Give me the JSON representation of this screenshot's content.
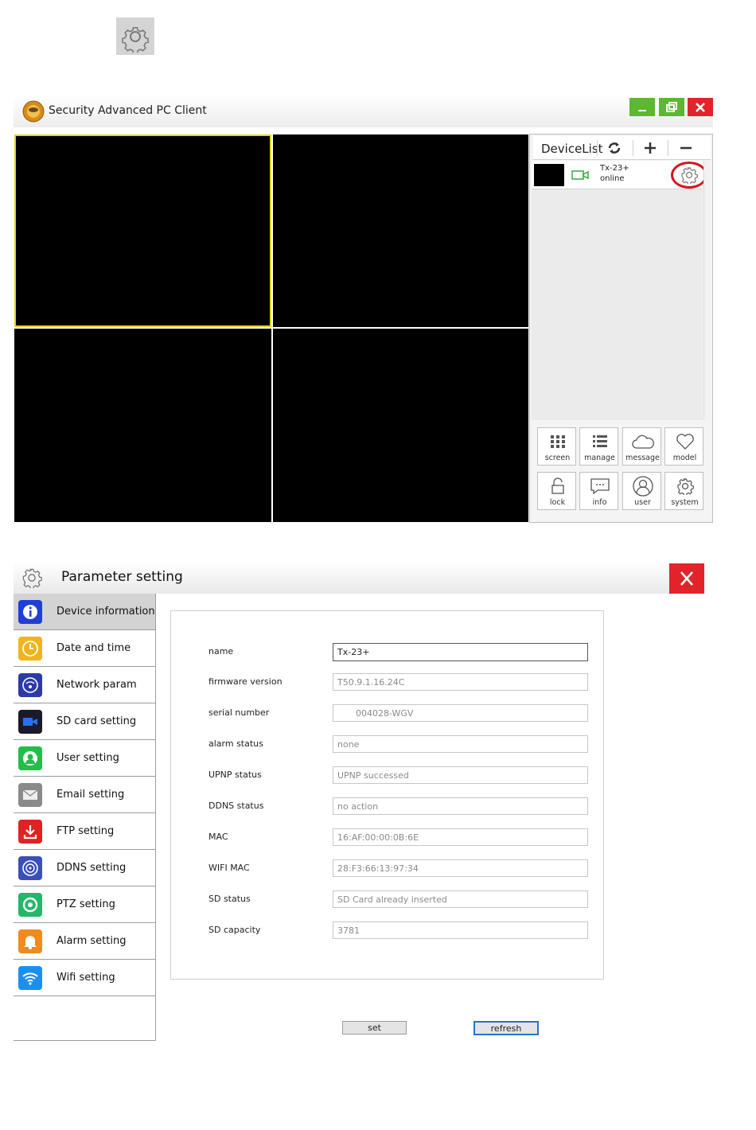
{
  "client": {
    "title": "Security Advanced PC Client",
    "device_list": {
      "title": "DeviceList",
      "devices": [
        {
          "name": "Tx-23+",
          "status": "online"
        }
      ]
    },
    "toolbar": [
      {
        "label": "screen",
        "icon": "grid-icon"
      },
      {
        "label": "manage",
        "icon": "list-icon"
      },
      {
        "label": "message",
        "icon": "cloud-icon"
      },
      {
        "label": "model",
        "icon": "heart-icon"
      },
      {
        "label": "lock",
        "icon": "lock-icon"
      },
      {
        "label": "info",
        "icon": "chat-icon"
      },
      {
        "label": "user",
        "icon": "user-icon"
      },
      {
        "label": "system",
        "icon": "gear-icon"
      }
    ]
  },
  "dialog": {
    "title": "Parameter setting",
    "close_label": "X",
    "menu": [
      {
        "label": "Device information",
        "icon": "info-icon",
        "color": "#1f3fd6"
      },
      {
        "label": "Date and time",
        "icon": "clock-icon",
        "color": "#f0b51c"
      },
      {
        "label": "Network param",
        "icon": "network-icon",
        "color": "#2c3aa8"
      },
      {
        "label": "SD card setting",
        "icon": "video-camera-icon",
        "color": "#1a1a2a"
      },
      {
        "label": "User setting",
        "icon": "user-icon",
        "color": "#1fbf4a"
      },
      {
        "label": "Email setting",
        "icon": "envelope-icon",
        "color": "#8a8a8a"
      },
      {
        "label": "FTP setting",
        "icon": "download-icon",
        "color": "#e02222"
      },
      {
        "label": "DDNS setting",
        "icon": "ddns-icon",
        "color": "#3a4fb8"
      },
      {
        "label": "PTZ setting",
        "icon": "ptz-icon",
        "color": "#22b86a"
      },
      {
        "label": "Alarm setting",
        "icon": "bell-icon",
        "color": "#f08a1c"
      },
      {
        "label": "Wifi setting",
        "icon": "wifi-icon",
        "color": "#1c8ef0"
      }
    ],
    "fields": [
      {
        "label": "name",
        "value": "Tx-23+"
      },
      {
        "label": "firmware version",
        "value": "T50.9.1.16.24C"
      },
      {
        "label": "serial number",
        "value": "004028-WGV"
      },
      {
        "label": "alarm status",
        "value": "none"
      },
      {
        "label": "UPNP status",
        "value": "UPNP successed"
      },
      {
        "label": "DDNS status",
        "value": "no action"
      },
      {
        "label": "MAC",
        "value": "16:AF:00:00:0B:6E"
      },
      {
        "label": "WIFI MAC",
        "value": "28:F3:66:13:97:34"
      },
      {
        "label": "SD status",
        "value": "SD Card already inserted"
      },
      {
        "label": "SD capacity",
        "value": "3781"
      }
    ],
    "buttons": {
      "set": "set",
      "refresh": "refresh"
    }
  }
}
